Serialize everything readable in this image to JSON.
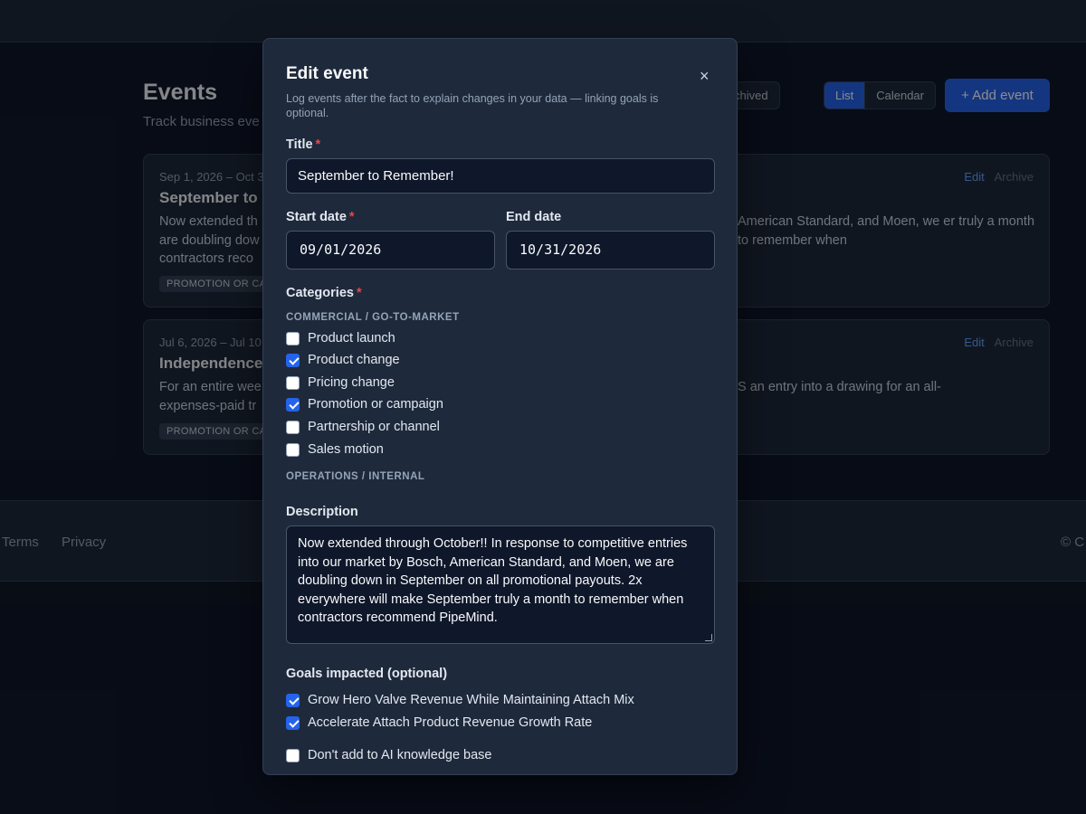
{
  "page": {
    "title": "Events",
    "subtitle": "Track business eve",
    "status_filter": {
      "options": [
        "",
        "Archived"
      ],
      "selected_index": 0
    },
    "view_toggle": {
      "options": [
        "List",
        "Calendar"
      ],
      "selected": "List"
    },
    "add_button_label": "+ Add event"
  },
  "events": [
    {
      "date": "Sep 1, 2026 – Oct 3",
      "title": "September to R",
      "desc_left": "Now extended th are doubling dow contractors reco",
      "desc_right": "American Standard, and Moen, we er truly a month to remember when",
      "tag": "PROMOTION OR CAM",
      "edit_label": "Edit",
      "archive_label": "Archive"
    },
    {
      "date": "Jul 6, 2026 – Jul 10,",
      "title": "Independence",
      "desc_left": "For an entire wee expenses-paid tr",
      "desc_right": "S an entry into a drawing for an all-",
      "tag": "PROMOTION OR CAM",
      "edit_label": "Edit",
      "archive_label": "Archive"
    }
  ],
  "footer": {
    "terms": "Terms",
    "privacy": "Privacy",
    "copyright": "© C"
  },
  "modal": {
    "title": "Edit event",
    "close_icon": "×",
    "subtitle": "Log events after the fact to explain changes in your data — linking goals is optional.",
    "title_label": "Title",
    "title_value": "September to Remember!",
    "start_label": "Start date",
    "start_value": "09/01/2026",
    "end_label": "End date",
    "end_value": "10/31/2026",
    "categories_label": "Categories",
    "group_commercial": "COMMERCIAL / GO-TO-MARKET",
    "categories": [
      {
        "label": "Product launch",
        "checked": false
      },
      {
        "label": "Product change",
        "checked": true
      },
      {
        "label": "Pricing change",
        "checked": false
      },
      {
        "label": "Promotion or campaign",
        "checked": true
      },
      {
        "label": "Partnership or channel",
        "checked": false
      },
      {
        "label": "Sales motion",
        "checked": false
      }
    ],
    "group_operations": "OPERATIONS / INTERNAL",
    "description_label": "Description",
    "description_value": "Now extended through October!!  In response to competitive entries into our market by Bosch, American Standard, and Moen, we are doubling down in September on all promotional payouts. 2x everywhere will make September truly a month to remember when contractors recommend PipeMind.",
    "goals_label": "Goals impacted (optional)",
    "goals": [
      {
        "label": "Grow Hero Valve Revenue While Maintaining Attach Mix",
        "checked": true
      },
      {
        "label": "Accelerate Attach Product Revenue Growth Rate",
        "checked": true
      }
    ],
    "kb_option": {
      "label": "Don't add to AI knowledge base",
      "checked": false
    }
  },
  "colors": {
    "accent": "#2563eb",
    "required": "#ef4444",
    "background": "#0f172a",
    "surface": "#1e293b"
  }
}
